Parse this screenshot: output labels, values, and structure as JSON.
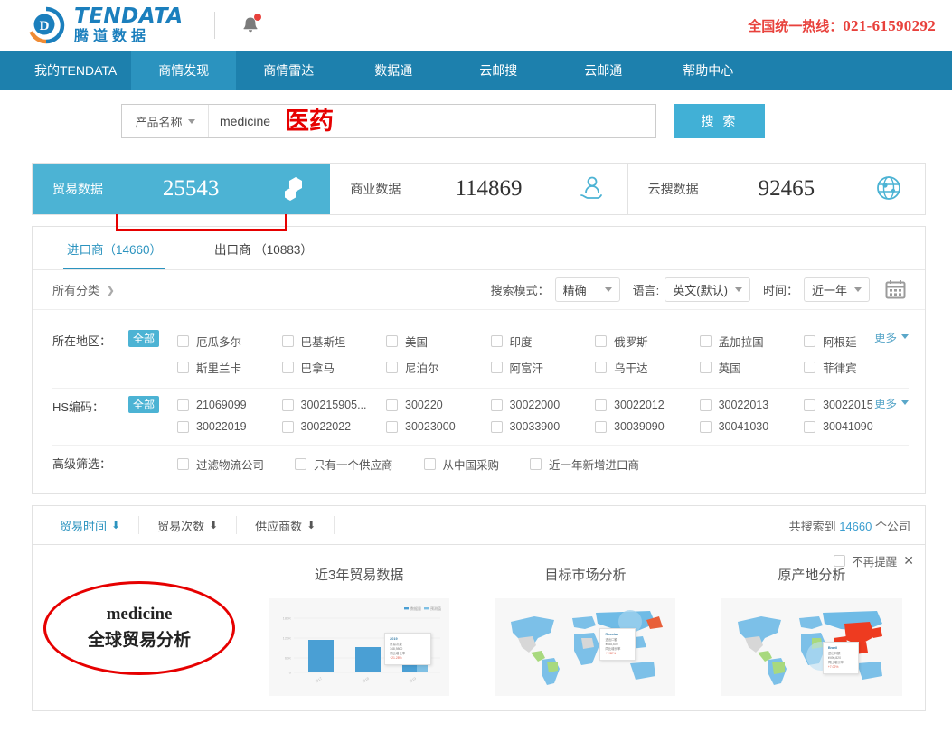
{
  "header": {
    "logo_en": "TENDATA",
    "logo_cn": "腾道数据",
    "bell_icon": "bell-icon",
    "hotline_label": "全国统一热线：",
    "hotline_number": "021-61590292",
    "accent": "#e8413c"
  },
  "nav": {
    "items": [
      {
        "label": "我的TENDATA",
        "active": false
      },
      {
        "label": "商情发现",
        "active": true
      },
      {
        "label": "商情雷达",
        "active": false
      },
      {
        "label": "数据通",
        "active": false
      },
      {
        "label": "云邮搜",
        "active": false
      },
      {
        "label": "云邮通",
        "active": false
      },
      {
        "label": "帮助中心",
        "active": false
      }
    ],
    "bg": "#1d80ad",
    "active_bg": "#2b93bf"
  },
  "search": {
    "type_label": "产品名称",
    "keyword": "medicine",
    "annotation": "医药",
    "button_label": "搜 索",
    "annotation_color": "#e60000",
    "button_bg": "#41b0d6"
  },
  "stats": [
    {
      "label": "贸易数据",
      "value": "25543",
      "icon": "molecule-icon",
      "active": true
    },
    {
      "label": "商业数据",
      "value": "114869",
      "icon": "handshake-person-icon",
      "active": false
    },
    {
      "label": "云搜数据",
      "value": "92465",
      "icon": "globe-search-icon",
      "active": false
    }
  ],
  "tabs": [
    {
      "label": "进口商（14660）",
      "active": true
    },
    {
      "label": "出口商 （10883）",
      "active": false
    }
  ],
  "filter_header": {
    "all_categories": "所有分类",
    "chevron_icon": "chevron-right-icon",
    "mode_label": "搜索模式：",
    "mode_value": "精确",
    "language_label": "语言:",
    "language_value": "英文(默认)",
    "time_label": "时间：",
    "time_value": "近一年",
    "calendar_icon": "calendar-icon"
  },
  "filters": [
    {
      "label": "所在地区：",
      "all_badge": "全部",
      "more_label": "更多",
      "options": [
        "厄瓜多尔",
        "巴基斯坦",
        "美国",
        "印度",
        "俄罗斯",
        "孟加拉国",
        "阿根廷",
        "斯里兰卡",
        "巴拿马",
        "尼泊尔",
        "阿富汗",
        "乌干达",
        "英国",
        "菲律宾"
      ]
    },
    {
      "label": "HS编码：",
      "all_badge": "全部",
      "more_label": "更多",
      "options": [
        "21069099",
        "300215905...",
        "300220",
        "30022000",
        "30022012",
        "30022013",
        "30022015",
        "30022019",
        "30022022",
        "30023000",
        "30033900",
        "30039090",
        "30041030",
        "30041090"
      ]
    }
  ],
  "advanced": {
    "label": "高级筛选：",
    "options": [
      "过滤物流公司",
      "只有一个供应商",
      "从中国采购",
      "近一年新增进口商"
    ]
  },
  "sort": {
    "items": [
      {
        "label": "贸易时间",
        "icon": "arrow-down-icon",
        "active": true
      },
      {
        "label": "贸易次数",
        "icon": "arrow-down-icon",
        "active": false
      },
      {
        "label": "供应商数",
        "icon": "arrow-down-icon",
        "active": false
      }
    ],
    "total_prefix": "共搜索到",
    "total_count": "14660",
    "total_suffix": "个公司"
  },
  "promo": {
    "dismiss_label": "不再提醒",
    "close_icon": "close-icon",
    "highlight_keyword": "medicine",
    "highlight_text": "全球贸易分析",
    "cards": [
      {
        "title": "近3年贸易数据",
        "thumb": "bar-chart-thumbnail"
      },
      {
        "title": "目标市场分析",
        "thumb": "world-map-thumbnail"
      },
      {
        "title": "原产地分析",
        "thumb": "world-map-origin-thumbnail"
      }
    ]
  },
  "chart_data": {
    "type": "bar",
    "title": "近3年贸易数据",
    "categories": [
      "2017",
      "2018",
      "2019"
    ],
    "values": [
      120,
      100,
      155
    ],
    "xlabel": "",
    "ylabel": "",
    "ylim": [
      0,
      180
    ],
    "yticks": [
      "0",
      "60K",
      "120K",
      "180K"
    ],
    "legend": [
      "数据量",
      "预测值"
    ],
    "grid": true,
    "bar_color": "#4a9fd4",
    "tooltip": {
      "year": "2019",
      "lines": [
        "贸易次数",
        "348,9800",
        "同比增长率",
        "+21.28%"
      ]
    }
  }
}
